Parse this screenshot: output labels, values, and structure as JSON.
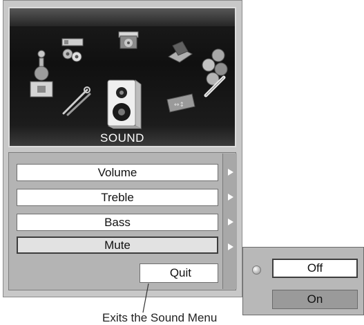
{
  "panel": {
    "title": "SOUND",
    "icons": [
      "pc-adjust-icon",
      "keystone-icon",
      "laptop-icon",
      "color-icon",
      "person-icon",
      "tools-icon",
      "speaker-icon",
      "screen-icon"
    ]
  },
  "menu": {
    "items": [
      {
        "label": "Volume",
        "selected": false
      },
      {
        "label": "Treble",
        "selected": false
      },
      {
        "label": "Bass",
        "selected": false
      },
      {
        "label": "Mute",
        "selected": true
      }
    ],
    "quit_label": "Quit"
  },
  "submenu": {
    "off_label": "Off",
    "on_label": "On",
    "selected": "Off"
  },
  "caption": "Exits the Sound Menu",
  "colors": {
    "panel_bg": "#101010",
    "menu_bg": "#c8c8c8",
    "item_bg": "#ffffff",
    "selected_bg": "#e2e2e2"
  }
}
